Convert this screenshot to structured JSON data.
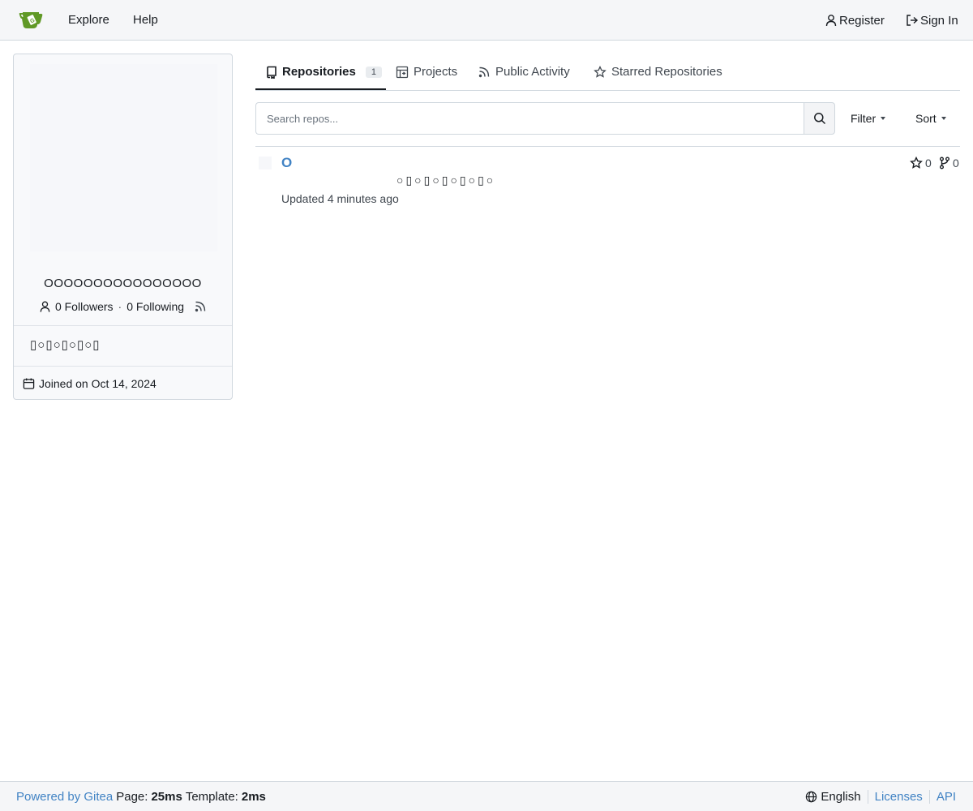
{
  "nav": {
    "explore": "Explore",
    "help": "Help",
    "register": "Register",
    "sign_in": "Sign In",
    "logo_icon": "gitea-tea-cup-logo",
    "logo_color": "#609926"
  },
  "profile": {
    "name": "OOOOOOOOOOOOOOOO",
    "followers": "0 Followers",
    "separator": "·",
    "following": "0 Following",
    "description": "▯○▯○▯○▯○▯",
    "joined": "Joined on Oct 14, 2024"
  },
  "tabs": [
    {
      "label": "Repositories",
      "count": "1",
      "icon": "repo-icon",
      "active": true
    },
    {
      "label": "Projects",
      "icon": "project-icon"
    },
    {
      "label": "Public Activity",
      "icon": "rss-icon"
    },
    {
      "label": "Starred Repositories",
      "icon": "star-icon"
    }
  ],
  "search": {
    "placeholder": "Search repos...",
    "filter_label": "Filter",
    "sort_label": "Sort"
  },
  "repos": [
    {
      "name": "O",
      "description": "○▯○▯○▯○▯○▯○",
      "updated_prefix": "Updated",
      "updated_time": "4 minutes ago",
      "stars": "0",
      "forks": "0"
    }
  ],
  "footer": {
    "powered_by": "Powered by Gitea",
    "page_label": "Page:",
    "page_time": "25ms",
    "template_label": "Template:",
    "template_time": "2ms",
    "language": "English",
    "licenses": "Licenses",
    "api": "API"
  },
  "colors": {
    "accent_link": "#4183c4",
    "navbar_bg": "#f5f6f8",
    "border": "#d0d7de"
  }
}
